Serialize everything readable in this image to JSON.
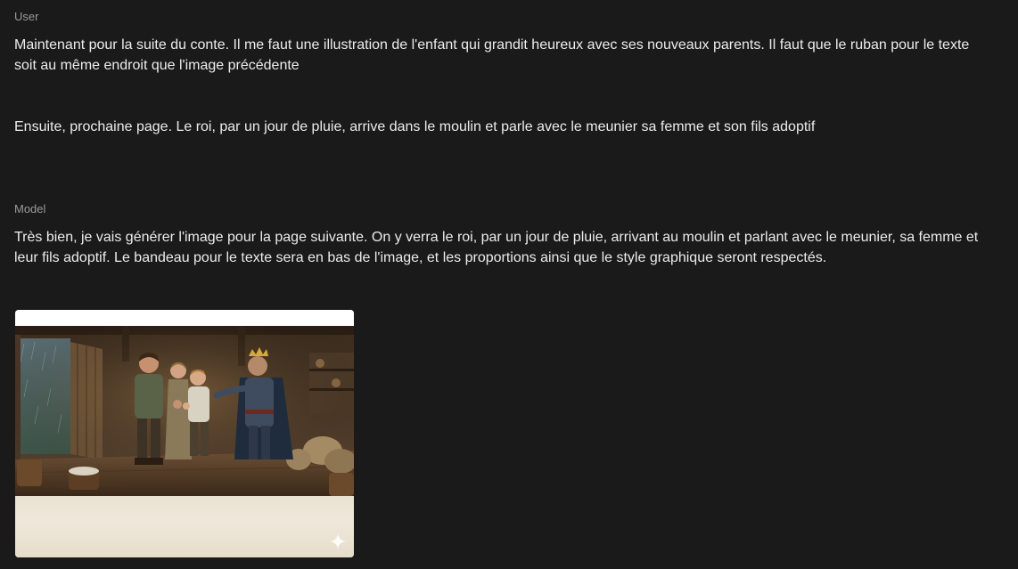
{
  "conversation": {
    "user": {
      "label": "User",
      "message_1": "Maintenant pour la suite du conte. Il me faut une illustration de l'enfant qui grandit heureux avec ses nouveaux parents. Il faut que le ruban pour le texte soit au même endroit que l'image précédente",
      "message_2": "Ensuite, prochaine page. Le roi, par un jour de pluie, arrive dans le moulin et parle avec le meunier sa femme et son fils adoptif"
    },
    "model": {
      "label": "Model",
      "message": "Très bien, je vais générer l'image pour la page suivante. On y verra le roi, par un jour de pluie, arrivant au moulin et parlant avec le meunier, sa femme et leur fils adoptif. Le bandeau pour le texte sera en bas de l'image, et les proportions ainsi que le style graphique seront respectés."
    }
  },
  "generated_image": {
    "icon": "sparkle-icon"
  },
  "colors": {
    "background": "#1a1a1a",
    "text": "#ececec",
    "label": "#9a9a9a",
    "ribbon": "#ebe3d4"
  }
}
